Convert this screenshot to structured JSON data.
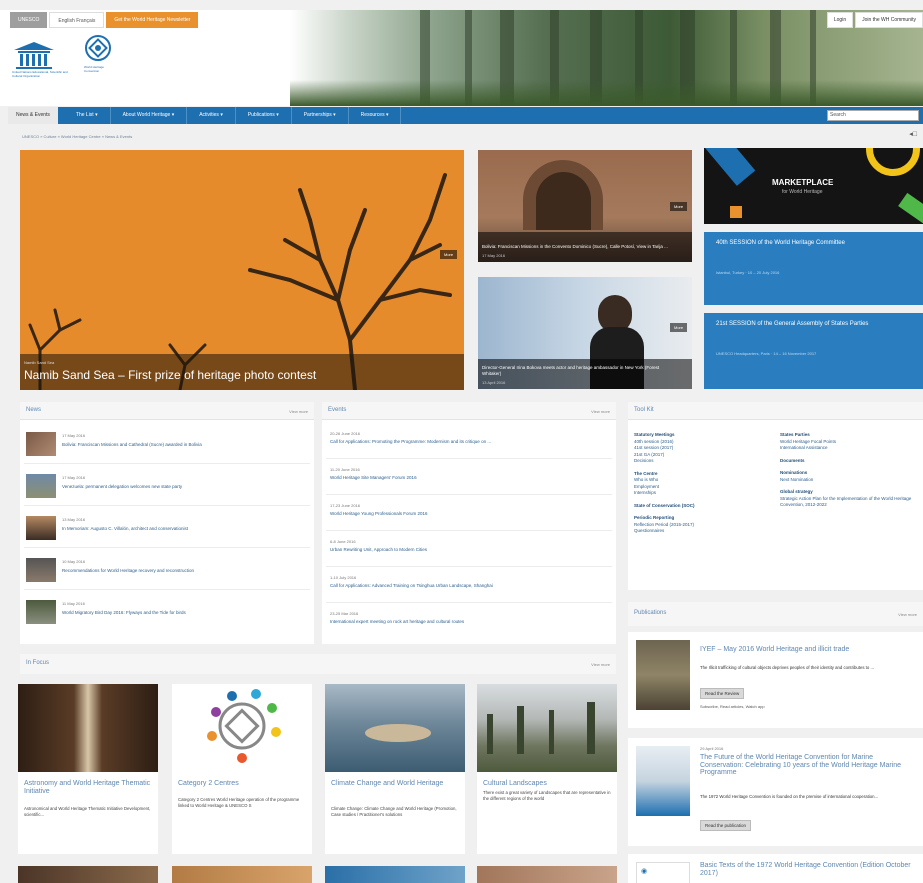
{
  "header": {
    "top_buttons": [
      "UNESCO",
      "English Français",
      "Get the World Heritage Newsletter"
    ],
    "login": "Login",
    "join": "Join the WH Community",
    "unesco_org": "United Nations Educational, Scientific and Cultural Organization",
    "whc_name": "World Heritage Convention"
  },
  "nav": {
    "home": "News & Events",
    "items": [
      "The List ▾",
      "About World Heritage ▾",
      "Activities ▾",
      "Publications ▾",
      "Partnerships ▾",
      "Resources ▾"
    ],
    "search_placeholder": "Search"
  },
  "breadcrumb": "UNESCO » Culture » World Heritage Centre » News & Events",
  "hero": {
    "kicker": "Namib Sand Sea",
    "title": "Namib Sand Sea – First prize of heritage photo contest",
    "more": "More"
  },
  "mid_cards": [
    {
      "title": "Bolivia: Franciscan Missions in the Convento Dominico (Sucre), Calle Potosí, View in Tarija ...",
      "date": "17 May 2016",
      "more": "More"
    },
    {
      "title": "Director-General Irina Bokova meets actor and heritage ambassador in New York (Forest Whitaker)",
      "date": "13 April 2016",
      "more": "More"
    }
  ],
  "promos": [
    {
      "title": "MARKETPLACE",
      "sub": "for World Heritage"
    },
    {
      "title": "40th SESSION of the World Heritage Committee",
      "sub": "Istanbul, Turkey · 10 – 20 July 2016"
    },
    {
      "title": "21st SESSION of the General Assembly of States Parties",
      "sub": "UNESCO Headquarters, Paris · 14 – 16 November 2017"
    }
  ],
  "news": {
    "heading": "News",
    "more": "View more",
    "items": [
      {
        "date": "17 May 2016",
        "text": "Bolivia: Franciscan Missions and Cathedral (Sucre) awarded in Bolivia"
      },
      {
        "date": "17 May 2016",
        "text": "Venezuela: permanent delegation welcomes new state party"
      },
      {
        "date": "13 May 2016",
        "text": "In Memoriam: Augusto C. Villalón, architect and conservationist"
      },
      {
        "date": "10 May 2016",
        "text": "Recommendations for World Heritage recovery and reconstruction"
      },
      {
        "date": "11 May 2016",
        "text": "World Migratory Bird Day 2016: Flyways and the Tide for birds"
      }
    ]
  },
  "events": {
    "heading": "Events",
    "more": "View more",
    "items": [
      {
        "date": "20-26 June 2016",
        "text": "Call for Applications: Promoting the Programme: Modernism and its critique on ..."
      },
      {
        "date": "11-20 June 2016",
        "text": "World Heritage Site Managers' Forum 2016"
      },
      {
        "date": "17-23 June 2016",
        "text": "World Heritage Young Professionals Forum 2016"
      },
      {
        "date": "6-8 June 2016",
        "text": "Urban Rewriting Unit, Approach to Modern Cities"
      },
      {
        "date": "1-10 July 2016",
        "text": "Call for Applications: Advanced Training on Tsinghua Urban Landscape, Shanghai"
      },
      {
        "date": "23-25 Mar 2016",
        "text": "International expert meeting on rock art heritage and cultural routes"
      }
    ]
  },
  "toolkit": {
    "heading": "Tool Kit",
    "left": [
      {
        "title": "Statutory Meetings",
        "lines": [
          "40th session (2016)",
          "41st session (2017)",
          "21st GA (2017)",
          "Decisions"
        ]
      },
      {
        "title": "The Centre",
        "lines": [
          "Who is Who",
          "Employment",
          "Internships"
        ]
      },
      {
        "title": "State of Conservation (SOC)",
        "lines": []
      },
      {
        "title": "Periodic Reporting",
        "lines": [
          "Reflection Period (2015-2017)",
          "Questionnaires"
        ]
      }
    ],
    "right": [
      {
        "title": "States Parties",
        "lines": [
          "World Heritage Focal Points",
          "International Assistance"
        ]
      },
      {
        "title": "Documents",
        "lines": []
      },
      {
        "title": "Nominations",
        "lines": [
          "Next Nomination"
        ]
      },
      {
        "title": "Global strategy",
        "lines": [
          "Strategic Action Plan for the Implementation of the World Heritage Convention, 2012-2022"
        ]
      }
    ]
  },
  "in_focus": {
    "heading": "In Focus",
    "more": "View more",
    "tiles": [
      {
        "title": "Astronomy and World Heritage Thematic Initiative",
        "text": "Astronomical and World Heritage Thematic Initiative Development, scientific..."
      },
      {
        "title": "Category 2 Centres",
        "text": "Category 2 Centres World Heritage operation of the programme linked to World Heritage & UNESCO S"
      },
      {
        "title": "Climate Change and World Heritage",
        "text": "Climate Change: Climate Change and World Heritage (Promotion, Case studies / Practitioner's solutions"
      },
      {
        "title": "Cultural Landscapes",
        "text": "There exist a great variety of Landscapes that are representative in the different regions of the world"
      }
    ]
  },
  "publications": {
    "heading": "Publications",
    "more": "View more",
    "items": [
      {
        "kicker": "",
        "title": "IYEF – May 2016 World Heritage and illicit trade",
        "text": "The Illicit trafficking of cultural objects deprives peoples of their identity and contributes to ...",
        "button": "Read the Review",
        "links": "Subscribe, Read articles, Watch app"
      },
      {
        "kicker": "29 April 2016",
        "title": "The Future of the World Heritage Convention for Marine Conservation: Celebrating 10 years of the World Heritage Marine Programme",
        "text": "The 1972 World Heritage Convention is founded on the premise of international cooperation...",
        "button": "Read the publication",
        "links": ""
      },
      {
        "kicker": "",
        "title": "Basic Texts of the 1972 World Heritage Convention (Edition October 2017)",
        "text": "",
        "button": "",
        "links": ""
      }
    ]
  }
}
